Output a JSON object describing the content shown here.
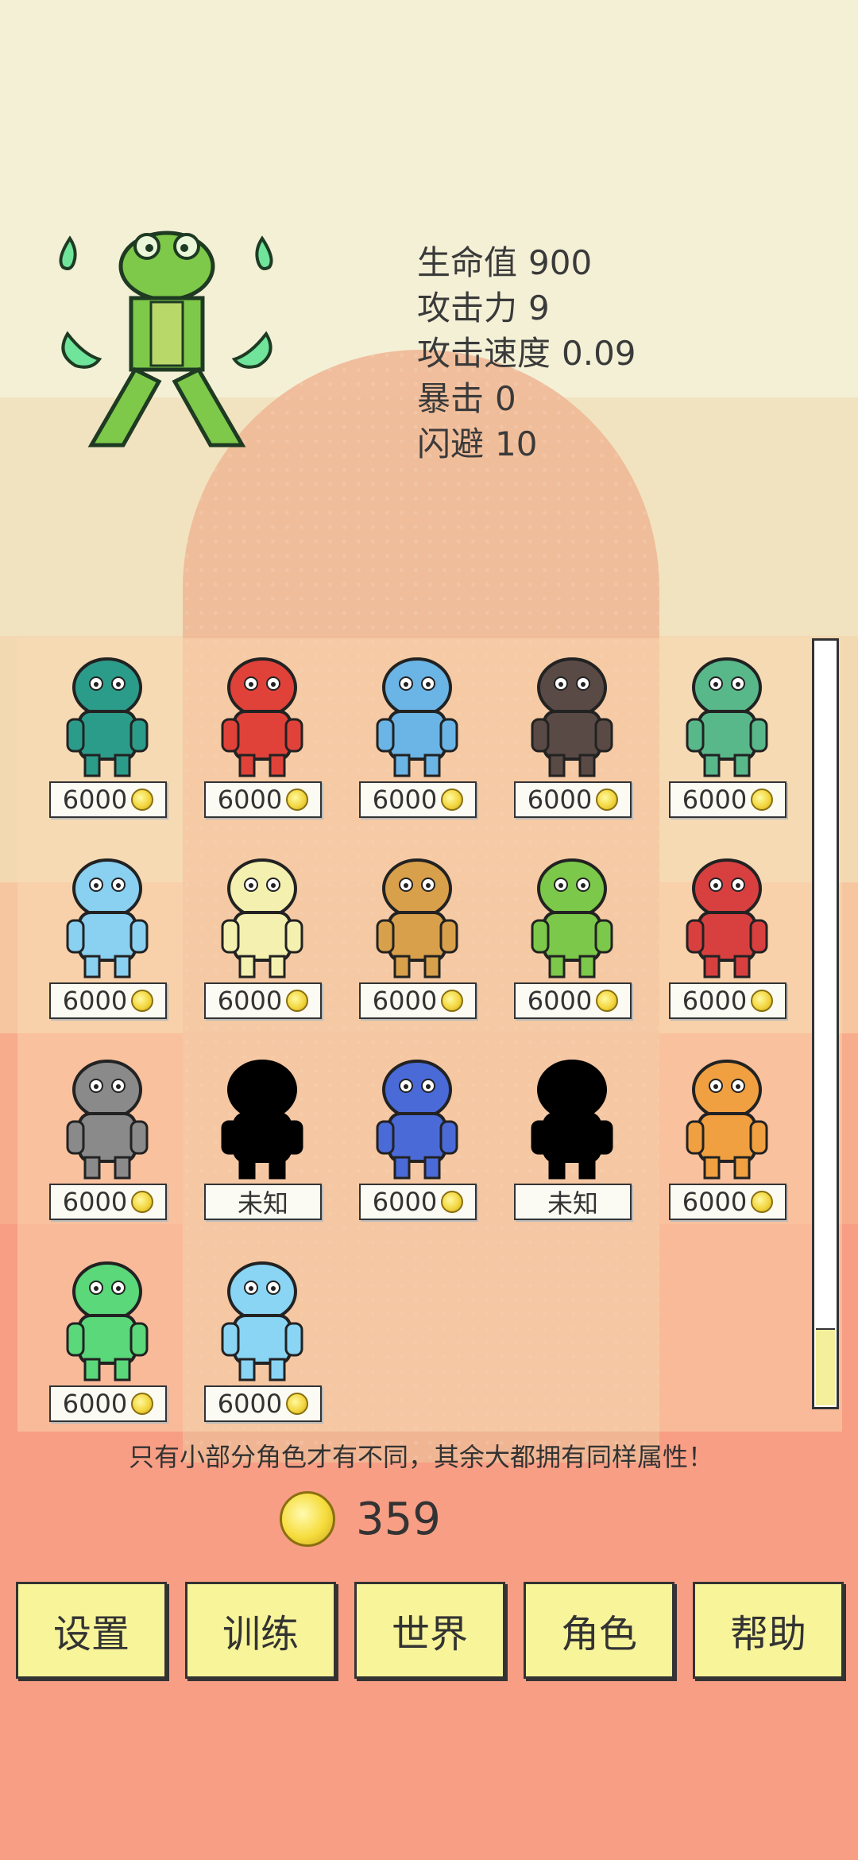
{
  "stats": [
    {
      "label": "生命值",
      "value": "900"
    },
    {
      "label": "攻击力",
      "value": "9"
    },
    {
      "label": "攻击速度",
      "value": "0.09"
    },
    {
      "label": "暴击",
      "value": "0"
    },
    {
      "label": "闪避",
      "value": "10"
    }
  ],
  "characters": [
    {
      "name": "crocodile-warrior",
      "price": "6000",
      "locked": false
    },
    {
      "name": "fox-chef",
      "price": "6000",
      "locked": false
    },
    {
      "name": "shark-swordsman",
      "price": "6000",
      "locked": false
    },
    {
      "name": "hermit-brute",
      "price": "6000",
      "locked": false
    },
    {
      "name": "mermaid-trident",
      "price": "6000",
      "locked": false
    },
    {
      "name": "blue-furry-monster",
      "price": "6000",
      "locked": false
    },
    {
      "name": "duck-warrior",
      "price": "6000",
      "locked": false
    },
    {
      "name": "striped-tongue-beast",
      "price": "6000",
      "locked": false
    },
    {
      "name": "green-lizard",
      "price": "6000",
      "locked": false
    },
    {
      "name": "red-dragon-hammer",
      "price": "6000",
      "locked": false
    },
    {
      "name": "grey-ghost",
      "price": "6000",
      "locked": false
    },
    {
      "name": "unknown-silhouette-1",
      "price": "未知",
      "locked": true
    },
    {
      "name": "bat-demon",
      "price": "6000",
      "locked": false
    },
    {
      "name": "unknown-silhouette-2",
      "price": "未知",
      "locked": true
    },
    {
      "name": "fire-spirit",
      "price": "6000",
      "locked": false
    },
    {
      "name": "green-tornado-spirit",
      "price": "6000",
      "locked": false
    },
    {
      "name": "water-spirit",
      "price": "6000",
      "locked": false
    }
  ],
  "hint": "只有小部分角色才有不同，其余大都拥有同样属性！",
  "coins": "359",
  "menu": {
    "settings": "设置",
    "training": "训练",
    "world": "世界",
    "characters": "角色",
    "help": "帮助"
  },
  "colors": {
    "button_fill": "#f7f49a",
    "coin": "#f3d740",
    "text": "#333333"
  }
}
